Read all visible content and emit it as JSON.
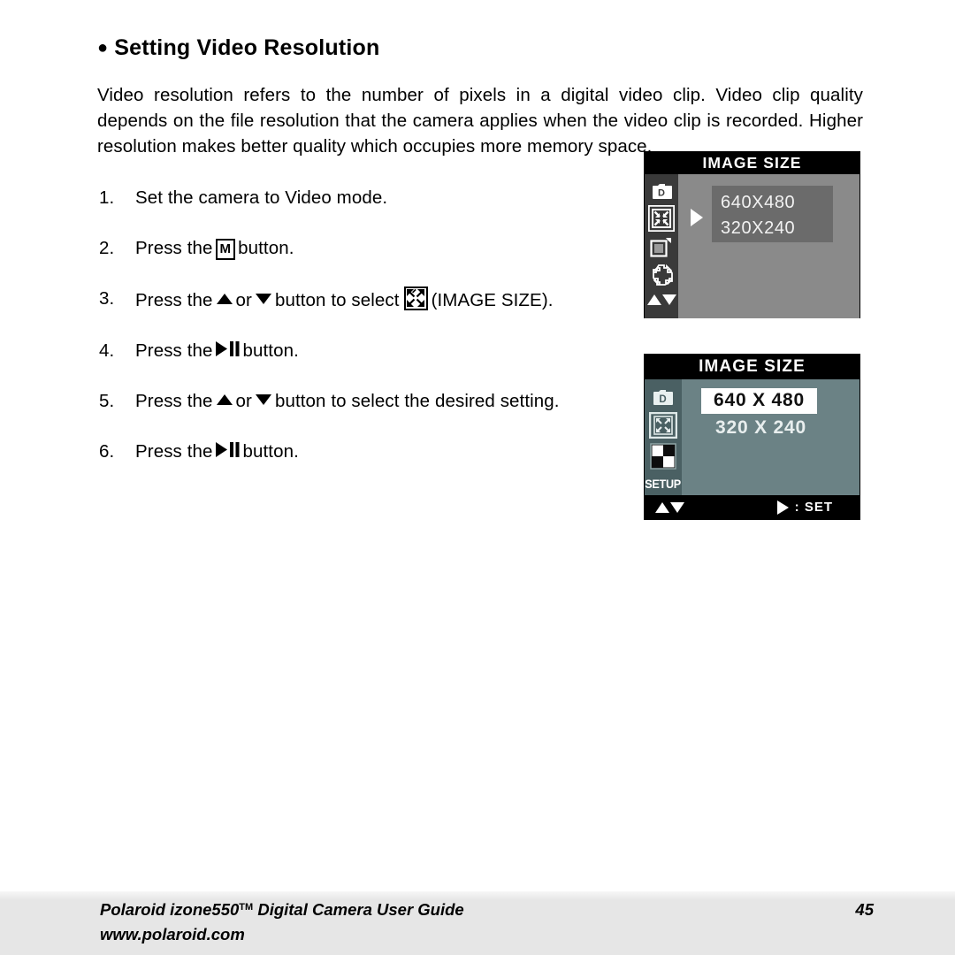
{
  "document": {
    "heading": "Setting Video Resolution",
    "heading_bullet": "bullet-dot-icon",
    "intro": "Video resolution refers to the number of pixels in a digital video clip. Video clip quality depends on the file resolution that the camera applies when the video clip is recorded. Higher resolution makes better quality which occupies more memory space.",
    "steps": [
      {
        "num": "1.",
        "text_before": "Set the camera to Video mode.",
        "icon": "",
        "text_after": ""
      },
      {
        "num": "2.",
        "text_before": "Press the",
        "icon": "mode-m-button-icon",
        "icon_label": "M",
        "text_after": "button."
      },
      {
        "num": "3.",
        "text_before": "Press the",
        "icon": "up-down-select-image-size",
        "text_after": "(IMAGE SIZE)."
      },
      {
        "num": "4.",
        "text_before": "Press the",
        "icon": "play-pause-button-icon",
        "text_after": "button."
      },
      {
        "num": "5.",
        "text_before": "Press the",
        "icon": "up-down-arrow-icons",
        "text_after": "button to select the desired setting."
      },
      {
        "num": "6.",
        "text_before": "Press the",
        "icon": "play-pause-button-icon",
        "text_after": "button."
      }
    ],
    "step3": {
      "press_the": "Press the",
      "or": "or",
      "button_to_select": "button to select",
      "trailing": "(IMAGE SIZE)."
    },
    "step5": {
      "press_the": "Press the",
      "or": "or",
      "trailing": "button to select the desired setting."
    },
    "step_press_the": "Press the",
    "step_button": "button."
  },
  "lcd_screen_1": {
    "title": "IMAGE SIZE",
    "options": [
      "640X480",
      "320X240"
    ],
    "cursor": "right-arrow-cursor-icon",
    "rail_icons": [
      "camera-d-icon",
      "image-size-icon",
      "quality-frame-icon",
      "sharpness-icon",
      "up-down-arrow-icon"
    ],
    "selected_rail_icon": "image-size-icon",
    "colors": {
      "title_bar": "#000000",
      "rail": "#3a3a3a",
      "body": "#8a8a8a",
      "option_box": "#6b6b6b",
      "text": "#f2f2f2"
    }
  },
  "lcd_screen_2": {
    "title": "IMAGE SIZE",
    "options": [
      {
        "label": "640 X 480",
        "selected": true
      },
      {
        "label": "320 X 240",
        "selected": false
      }
    ],
    "rail_icons": [
      "camera-d-icon",
      "image-size-icon",
      "checkerboard-quality-icon"
    ],
    "rail_setup_label": "SETUP",
    "selected_rail_icon": "image-size-icon",
    "footer": {
      "left_icon": "up-down-arrow-icon",
      "right_icon": "right-arrow-icon",
      "right_label": ": SET"
    },
    "colors": {
      "title_bar": "#000000",
      "rail": "#4a6063",
      "body": "#6b8285",
      "selected_bg": "#ffffff",
      "selected_text": "#111111",
      "unselected_text": "#e8eeee",
      "footer_bar": "#000000"
    }
  },
  "footer": {
    "guide_title": "Polaroid izone550",
    "trademark": "TM",
    "guide_title_rest": " Digital Camera User Guide",
    "website": "www.polaroid.com",
    "page_number": "45"
  }
}
